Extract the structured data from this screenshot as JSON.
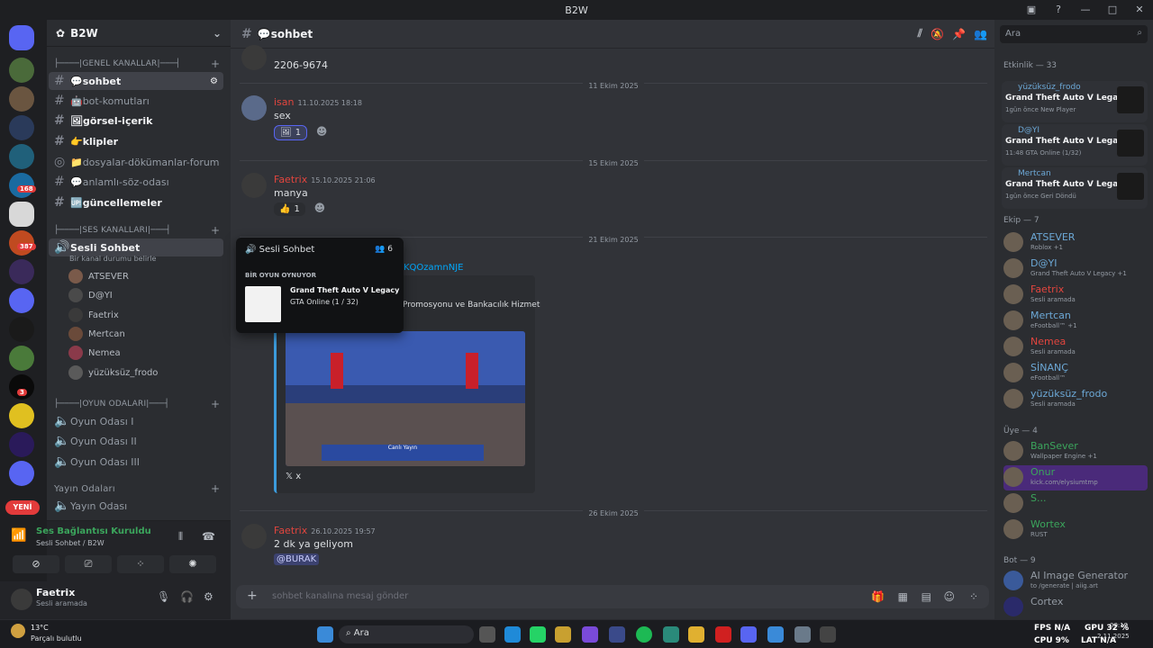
{
  "window": {
    "title": "B2W"
  },
  "server": {
    "name": "B2W",
    "badges": [
      "168",
      "387",
      "3"
    ]
  },
  "new_label": "YENİ",
  "categories": {
    "general": "├────|GENEL KANALLAR|───┤",
    "voice": "├────|SES KANALLARI|───┤",
    "games": "├────|OYUN ODALARI|───┤",
    "rooms": "Yayın Odaları"
  },
  "channels": [
    "sohbet",
    "bot-komutları",
    "görsel-içerik",
    "klipler",
    "dosyalar-dökümanlar-forum",
    "anlamlı-söz-odası",
    "güncellemeler"
  ],
  "voice_channel": {
    "name": "Sesli Sohbet",
    "status": "Bir kanal durumu belirle"
  },
  "voice_members": [
    "ATSEVER",
    "D@YI",
    "Faetrix",
    "Mertcan",
    "Nemea",
    "yüzüksüz_frodo"
  ],
  "game_rooms": [
    "Oyun Odası I",
    "Oyun Odası II",
    "Oyun Odası III"
  ],
  "stream_room": "Yayın Odası",
  "voice_panel": {
    "status": "Ses Bağlantısı Kuruldu",
    "channel": "Sesli Sohbet / B2W"
  },
  "user_panel": {
    "name": "Faetrix",
    "status": "Sesli aramada"
  },
  "chat": {
    "channel": "sohbet",
    "input_placeholder": "sohbet kanalına mesaj gönder",
    "msg0": {
      "text": "2206-9674"
    },
    "date1": "11 Ekim 2025",
    "msg1": {
      "author": "isan",
      "time": "11.10.2025 18:18",
      "text": "sex",
      "react": "1"
    },
    "date2": "15 Ekim 2025",
    "msg2": {
      "author": "Faetrix",
      "time": "15.10.2025 21:06",
      "text": "manya",
      "react": "1"
    },
    "date3": "21 Ekim 2025",
    "link_partial": "KQOzamnNJE",
    "embed_title": "Promosyonu ve Bankacılık Hizmet",
    "embed_caption": "Canlı Yayın",
    "embed_footer": "x",
    "date4": "26 Ekim 2025",
    "msg3": {
      "author": "Faetrix",
      "time": "26.10.2025 19:57",
      "text": "2 dk ya geliyom",
      "mention": "@BURAK"
    }
  },
  "popup": {
    "title": "Sesli Sohbet",
    "count": "6",
    "section": "BİR OYUN OYNUYOR",
    "game": "Grand Theft Auto V Legacy",
    "detail": "GTA Online (1 / 32)"
  },
  "search_placeholder": "Ara",
  "activity": {
    "header": "Etkinlik — 33",
    "items": [
      {
        "name": "yüzüksüz_frodo",
        "game": "Grand Theft Auto V Legacy",
        "status": "1gün önce  New Player"
      },
      {
        "name": "D@YI",
        "game": "Grand Theft Auto V Legacy",
        "status": "11:48  GTA Online (1/32)"
      },
      {
        "name": "Mertcan",
        "game": "Grand Theft Auto V Legacy",
        "status": "1gün önce  Geri Döndü"
      }
    ]
  },
  "groups": [
    {
      "header": "Ekip — 7",
      "members": [
        {
          "name": "ATSEVER",
          "status": "Roblox +1",
          "color": "#6ca8d6"
        },
        {
          "name": "D@YI",
          "status": "Grand Theft Auto V Legacy +1",
          "color": "#6ca8d6"
        },
        {
          "name": "Faetrix",
          "status": "Sesli aramada",
          "color": "#e2453e"
        },
        {
          "name": "Mertcan",
          "status": "eFootball™ +1",
          "color": "#6ca8d6"
        },
        {
          "name": "Nemea",
          "status": "Sesli aramada",
          "color": "#e2453e"
        },
        {
          "name": "SİNANÇ",
          "status": "eFootball™",
          "color": "#6ca8d6"
        },
        {
          "name": "yüzüksüz_frodo",
          "status": "Sesli aramada",
          "color": "#6ca8d6"
        }
      ]
    },
    {
      "header": "Üye — 4",
      "members": [
        {
          "name": "BanSever",
          "status": "Wallpaper Engine +1",
          "color": "#3ba55c"
        },
        {
          "name": "Onur",
          "status": "kick.com/elysiumtmp",
          "color": "#3ba55c"
        },
        {
          "name": "S...",
          "status": "",
          "color": "#3ba55c"
        },
        {
          "name": "Wortex",
          "status": "RUST",
          "color": "#3ba55c"
        }
      ]
    },
    {
      "header": "Bot — 9",
      "members": [
        {
          "name": "AI Image Generator",
          "status": "to /generate | aiig.art",
          "color": "#949ba4"
        },
        {
          "name": "Cortex",
          "status": "",
          "color": "#949ba4"
        }
      ]
    }
  ],
  "taskbar": {
    "weather_temp": "13°C",
    "weather_desc": "Parçalı bulutlu",
    "search": "Ara",
    "fps": "FPS N/A",
    "gpu": "GPU 32 %",
    "cpu": "CPU 9%",
    "lat": "LAT N/A",
    "time": "00:19",
    "date": "2.11.2025"
  }
}
